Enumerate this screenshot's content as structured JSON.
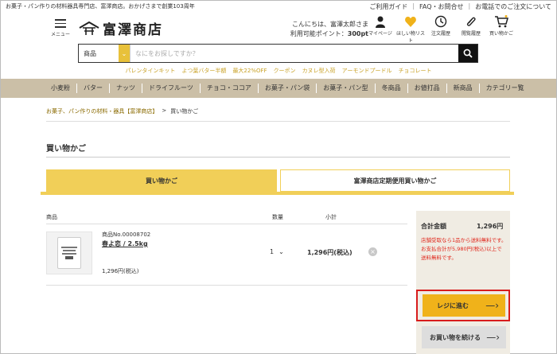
{
  "top": {
    "tagline": "お菓子・パン作りの材料器具専門店、富澤商店。おかげさまで創業103周年",
    "links": [
      "ご利用ガイド",
      "FAQ・お問合せ",
      "お電話でのご注文について"
    ]
  },
  "header": {
    "menu_label": "メニュー",
    "logo_text": "富澤商店",
    "greeting_line1": "こんにちは、富澤太郎さま",
    "points_label": "利用可能ポイント：",
    "points_value": "300pt",
    "icons": [
      {
        "label": "マイページ",
        "icon": "person-icon"
      },
      {
        "label": "ほしい物リスト",
        "icon": "heart-icon"
      },
      {
        "label": "注文履歴",
        "icon": "clock-icon"
      },
      {
        "label": "閲覧履歴",
        "icon": "paperclip-icon"
      },
      {
        "label": "買い物かご",
        "icon": "cart-icon"
      }
    ]
  },
  "search": {
    "category": "商品",
    "placeholder": "なにをお探しですか？"
  },
  "promo": [
    "パレンタインキット",
    "よつ葉バター半額",
    "最大22%OFF",
    "クーポン",
    "カヌレ型入荷",
    "アーモンドプードル",
    "チョコレート"
  ],
  "categories": [
    "小麦粉",
    "バター",
    "ナッツ",
    "ドライフルーツ",
    "チョコ・ココア",
    "お菓子・パン袋",
    "お菓子・パン型",
    "冬商品",
    "お値打品",
    "新商品",
    "カテゴリー覧"
  ],
  "breadcrumb": {
    "home": "お菓子、パン作りの材料・器具【富澤商店】",
    "sep": ">",
    "current": "買い物かご"
  },
  "page_title": "買い物かご",
  "tabs": [
    "買い物かご",
    "富澤商店定期便用買い物かご"
  ],
  "table": {
    "headers": {
      "product": "商品",
      "qty": "数量",
      "subtotal": "小計"
    },
    "rows": [
      {
        "product_no": "商品No.00008702",
        "name": "春よ恋 / 2.5kg",
        "unit_price": "1,296円(税込)",
        "qty": "1",
        "subtotal": "1,296円(税込)"
      }
    ]
  },
  "summary": {
    "total_label": "合計金額",
    "total_value": "1,296円",
    "note1": "店舗受取なら1品から送料無料です。",
    "note2": "お支払合計が5,980円(税込)以上で送料無料です。",
    "checkout_label": "レジに進む",
    "continue_label": "お買い物を続ける"
  },
  "colors": {
    "accent_yellow": "#f1cf58",
    "checkout_orange": "#f0b21a",
    "nav_bg": "#cbbfa7",
    "alert_red": "#e0271c",
    "highlight_red": "#d81c1c"
  }
}
